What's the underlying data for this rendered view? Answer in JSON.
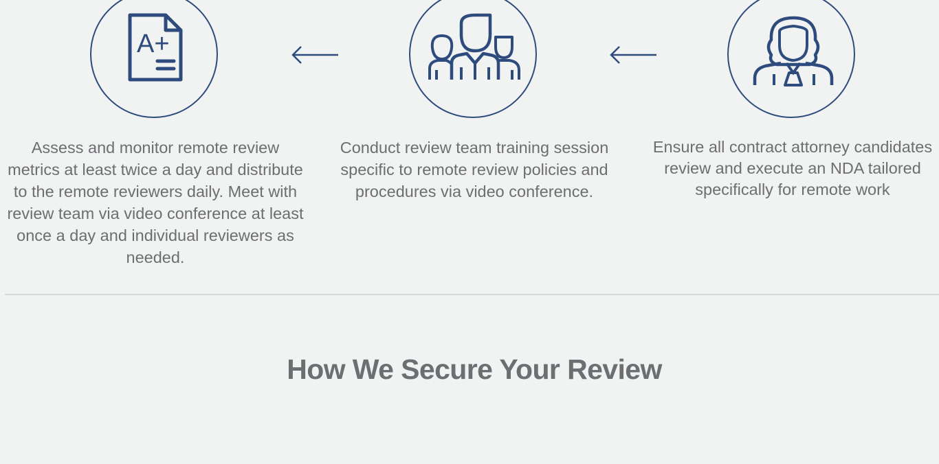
{
  "process": {
    "steps": [
      {
        "icon": "grade-document-icon",
        "icon_text": "A+",
        "text": "Assess and monitor remote review metrics at least twice a day and distribute to the remote reviewers daily. Meet with review team via video conference at least once a day and individual reviewers as needed."
      },
      {
        "icon": "review-team-icon",
        "text": "Conduct review team training session specific to remote review policies and procedures via video conference."
      },
      {
        "icon": "attorney-icon",
        "text": "Ensure all contract attorney candidates review and execute an NDA tailored specifically for remote work"
      }
    ],
    "arrows": [
      "arrow-left-icon",
      "arrow-left-icon"
    ]
  },
  "section": {
    "heading": "How We Secure Your Review"
  },
  "colors": {
    "icon_stroke": "#2e4b7d",
    "body_text": "#6d6e71",
    "background": "#f1f2f2",
    "divider": "#d8d9da"
  }
}
